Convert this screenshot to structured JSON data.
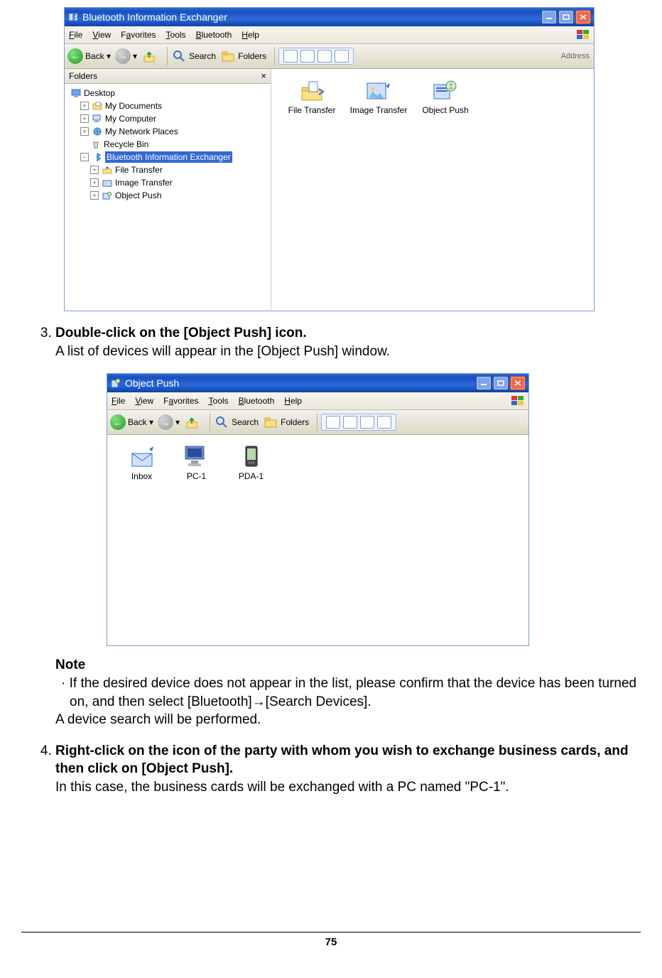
{
  "win1": {
    "title": "Bluetooth Information Exchanger",
    "menu": {
      "file": "File",
      "view": "View",
      "favorites": "Favorites",
      "tools": "Tools",
      "bluetooth": "Bluetooth",
      "help": "Help"
    },
    "toolbar": {
      "back": "Back",
      "search": "Search",
      "folders": "Folders",
      "address": "Address"
    },
    "folders_label": "Folders",
    "tree": {
      "desktop": "Desktop",
      "mydocs": "My Documents",
      "mycomp": "My Computer",
      "mynet": "My Network Places",
      "recycle": "Recycle Bin",
      "bie": "Bluetooth Information Exchanger",
      "ft": "File Transfer",
      "it": "Image Transfer",
      "op": "Object Push"
    },
    "icons": {
      "ft": "File Transfer",
      "it": "Image Transfer",
      "op": "Object Push"
    }
  },
  "step3": {
    "title": "Double-click on the [Object Push] icon.",
    "body": "A list of devices will appear in the [Object Push] window."
  },
  "win2": {
    "title": "Object Push",
    "menu": {
      "file": "File",
      "view": "View",
      "favorites": "Favorites",
      "tools": "Tools",
      "bluetooth": "Bluetooth",
      "help": "Help"
    },
    "toolbar": {
      "back": "Back",
      "search": "Search",
      "folders": "Folders"
    },
    "icons": {
      "inbox": "Inbox",
      "pc1": "PC-1",
      "pda1": "PDA-1"
    }
  },
  "note": {
    "head": "Note",
    "body": "If the desired device does not appear in the list, please confirm that the device has been turned on, and then select [Bluetooth]→[Search Devices].",
    "body2": "A device search will be performed."
  },
  "step4": {
    "title": "Right-click on the icon of the party with whom you wish to exchange business cards, and then click on [Object Push].",
    "body": "In this case, the business cards will be exchanged with a PC named \"PC-1\"."
  },
  "page": "75"
}
